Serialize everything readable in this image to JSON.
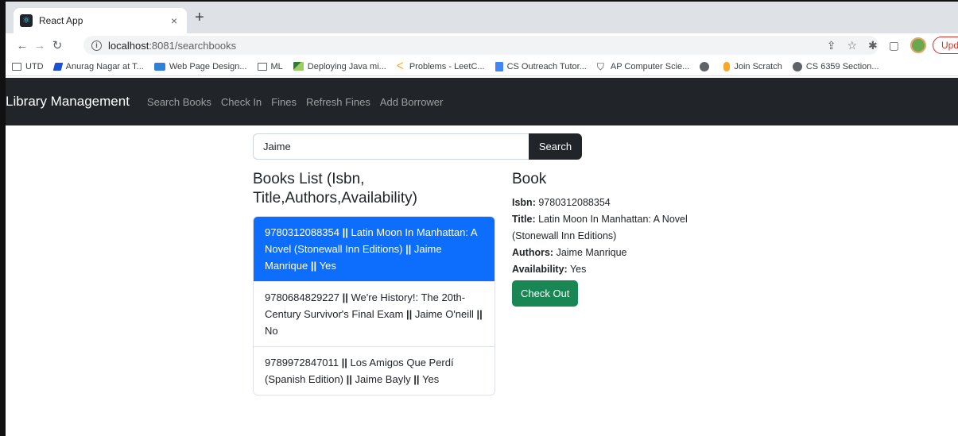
{
  "browser": {
    "tab_title": "React App",
    "tab_close": "×",
    "new_tab": "+",
    "url_host": "localhost",
    "url_path": ":8081/searchbooks",
    "update_label": "Upd",
    "bookmarks": [
      "UTD",
      "Anurag Nagar at T...",
      "Web Page Design...",
      "ML",
      "Deploying Java mi...",
      "Problems - LeetC...",
      "CS Outreach Tutor...",
      "AP Computer Scie...",
      "",
      "Join Scratch",
      "CS 6359 Section..."
    ]
  },
  "navbar": {
    "brand": "Library Management",
    "links": [
      "Search Books",
      "Check In",
      "Fines",
      "Refresh Fines",
      "Add Borrower"
    ]
  },
  "search": {
    "value": "Jaime",
    "button_label": "Search"
  },
  "books_list": {
    "heading": "Books List (Isbn, Title,Authors,Availability)",
    "separator": "||",
    "items": [
      {
        "isbn": "9780312088354",
        "title": "Latin Moon In Manhattan: A Novel (Stonewall Inn Editions)",
        "authors": "Jaime Manrique",
        "availability": "Yes",
        "active": true
      },
      {
        "isbn": "9780684829227",
        "title": "We're History!: The 20th-Century Survivor's Final Exam",
        "authors": "Jaime O'neill",
        "availability": "No",
        "active": false
      },
      {
        "isbn": "9789972847011",
        "title": "Los Amigos Que Perdí (Spanish Edition)",
        "authors": "Jaime Bayly",
        "availability": "Yes",
        "active": false
      }
    ]
  },
  "book_detail": {
    "heading": "Book",
    "isbn_label": "Isbn:",
    "isbn": "9780312088354",
    "title_label": "Title:",
    "title": "Latin Moon In Manhattan: A Novel (Stonewall Inn Editions)",
    "authors_label": "Authors:",
    "authors": "Jaime Manrique",
    "availability_label": "Availability:",
    "availability": "Yes",
    "checkout_label": "Check Out"
  },
  "colors": {
    "navbar_bg": "#212529",
    "active_item": "#0d6efd",
    "checkout_btn": "#198754",
    "update_btn": "#d93025"
  }
}
